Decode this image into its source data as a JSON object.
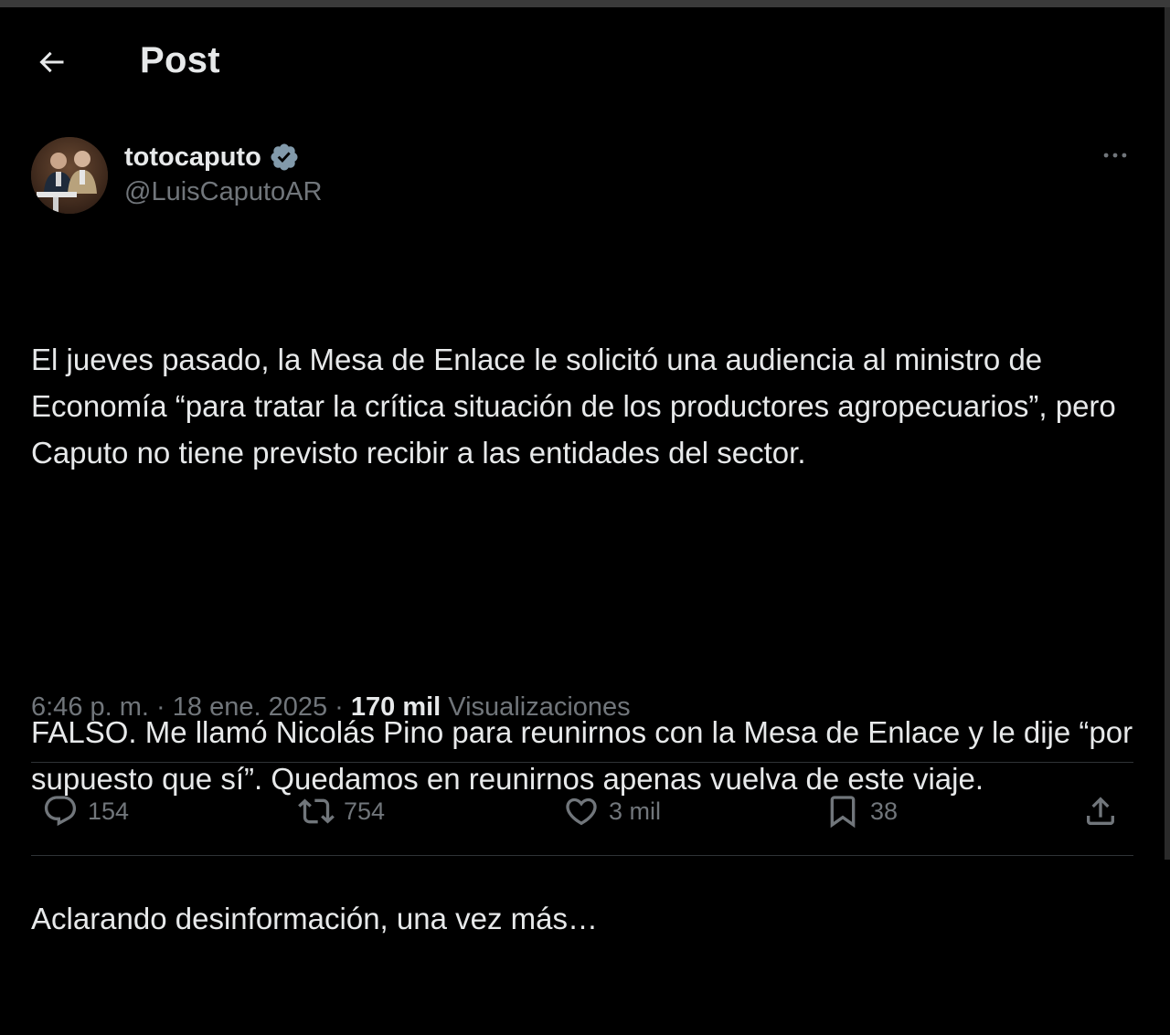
{
  "header": {
    "title": "Post",
    "back_icon": "arrow-left-icon"
  },
  "author": {
    "display_name": "totocaputo",
    "handle": "@LuisCaputoAR",
    "verified_icon": "verified-badge-icon",
    "verified_color": "#829aab"
  },
  "tweet": {
    "paragraph_1": "El jueves pasado, la Mesa de Enlace le solicitó una audiencia al ministro de Economía “para tratar la crítica situación de los productores agropecuarios”, pero Caputo no tiene previsto recibir a las entidades del sector.",
    "paragraph_2": "FALSO. Me llamó Nicolás Pino para reunirnos con la Mesa de Enlace y le dije “por supuesto que sí”. Quedamos en reunirnos apenas vuelva de este viaje.",
    "paragraph_3": "Aclarando desinformación, una vez más…"
  },
  "meta": {
    "time": "6:46 p. m.",
    "separator": "·",
    "date": "18 ene. 2025",
    "views_count": "170 mil",
    "views_label": "Visualizaciones"
  },
  "actions": {
    "reply_count": "154",
    "retweet_count": "754",
    "like_count": "3 mil",
    "bookmark_count": "38"
  },
  "colors": {
    "background": "#000000",
    "text_primary": "#e7e9ea",
    "text_secondary": "#71767b",
    "divider": "#2f3336"
  }
}
